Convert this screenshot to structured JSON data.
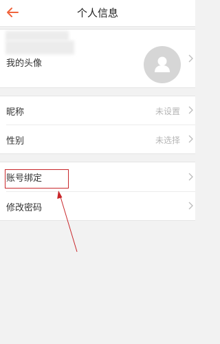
{
  "header": {
    "title": "个人信息",
    "back_icon": "back-arrow-icon",
    "accent_color": "#f0643c"
  },
  "profile": {
    "avatar_label": "我的头像",
    "avatar_icon": "user-avatar-icon"
  },
  "basic_info": {
    "nickname_label": "昵称",
    "nickname_value": "未设置",
    "gender_label": "性别",
    "gender_value": "未选择"
  },
  "account": {
    "bind_label": "账号绑定",
    "password_label": "修改密码"
  },
  "annotation": {
    "color": "#c8262a"
  },
  "icons": {
    "chevron": "chevron-right-icon"
  }
}
